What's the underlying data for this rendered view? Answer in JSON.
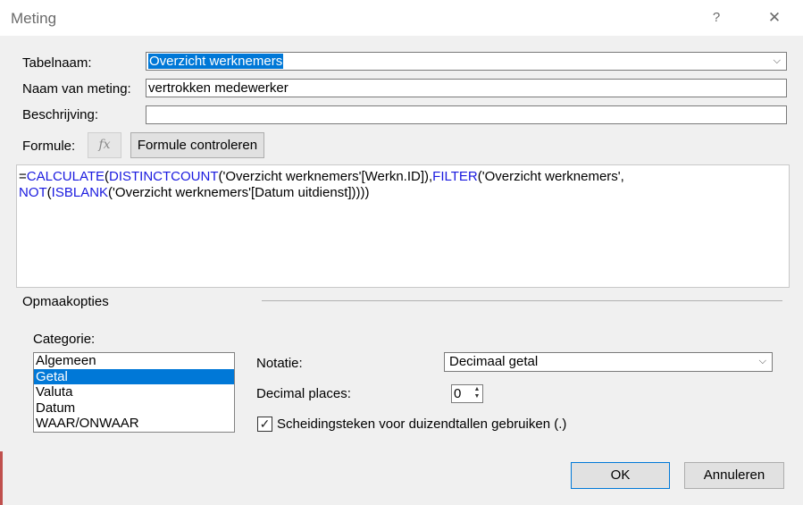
{
  "window": {
    "title": "Meting",
    "help_label": "?",
    "close_label": "✕"
  },
  "fields": {
    "table_name_label": "Tabelnaam:",
    "table_name_value": "Overzicht werknemers",
    "measure_name_label": "Naam van meting:",
    "measure_name_value": "vertrokken medewerker",
    "description_label": "Beschrijving:",
    "description_value": "",
    "formula_label": "Formule:",
    "fx_label": "fx",
    "check_formula_button": "Formule controleren"
  },
  "formula": {
    "line1": [
      {
        "t": "=",
        "kw": false
      },
      {
        "t": "CALCULATE",
        "kw": true
      },
      {
        "t": "(",
        "kw": false
      },
      {
        "t": "DISTINCTCOUNT",
        "kw": true
      },
      {
        "t": "('Overzicht werknemers'[Werkn.ID]),",
        "kw": false
      },
      {
        "t": "FILTER",
        "kw": true
      },
      {
        "t": "('Overzicht werknemers',",
        "kw": false
      }
    ],
    "line2": [
      {
        "t": "NOT",
        "kw": true
      },
      {
        "t": "(",
        "kw": false
      },
      {
        "t": "ISBLANK",
        "kw": true
      },
      {
        "t": "('Overzicht werknemers'[Datum uitdienst]))))",
        "kw": false
      }
    ]
  },
  "format": {
    "group_label": "Opmaakopties",
    "category_label": "Categorie:",
    "categories": [
      "Algemeen",
      "Getal",
      "Valuta",
      "Datum",
      "WAAR/ONWAAR"
    ],
    "selected_category": "Getal",
    "notation_label": "Notatie:",
    "notation_value": "Decimaal getal",
    "decimal_label": "Decimal places:",
    "decimal_value": "0",
    "separator_label": "Scheidingsteken voor duizendtallen gebruiken (.)",
    "separator_checked": true
  },
  "buttons": {
    "ok": "OK",
    "cancel": "Annuleren"
  },
  "colors": {
    "selection": "#0078d7",
    "keyword": "#1a1adf"
  }
}
